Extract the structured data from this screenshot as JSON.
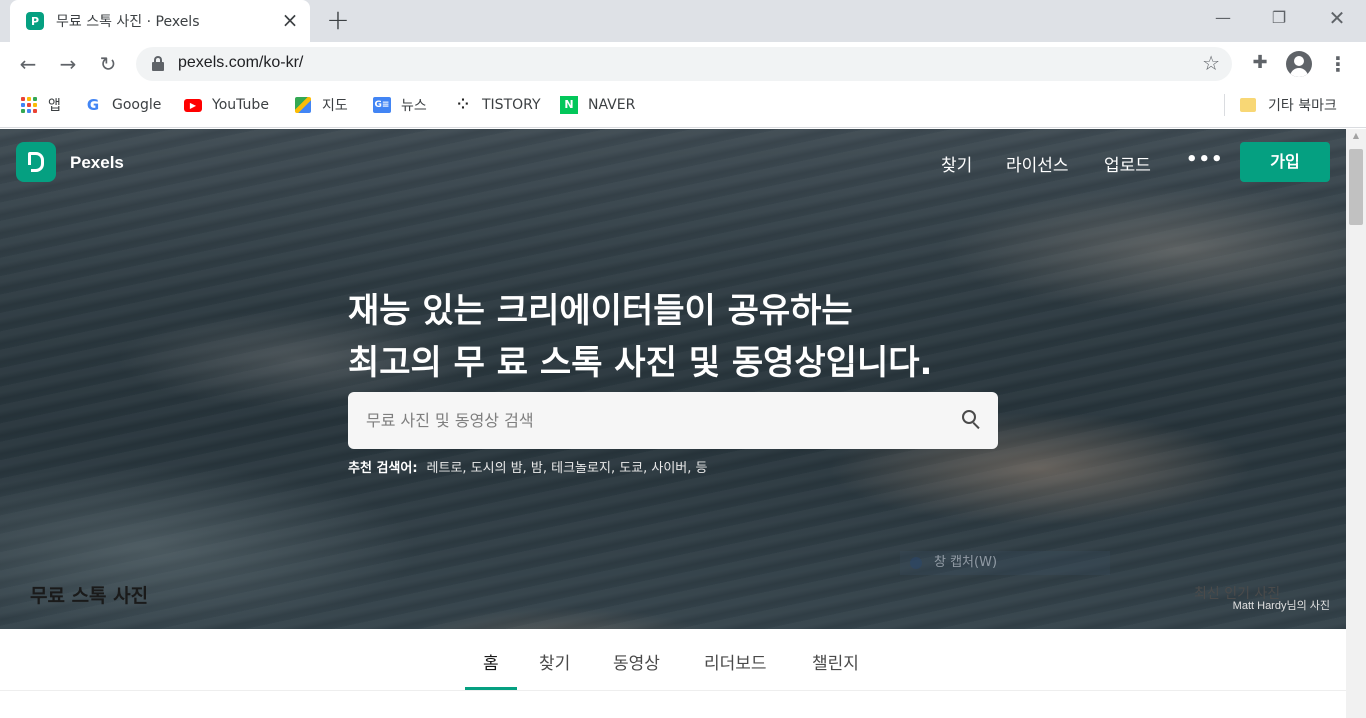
{
  "browser": {
    "tab": {
      "title": "무료 스톡 사진 · Pexels",
      "favicon": "P"
    },
    "url": "pexels.com/ko-kr/",
    "bookmarks": [
      {
        "label": "앱",
        "icon": "apps-icon"
      },
      {
        "label": "Google",
        "icon": "google-icon"
      },
      {
        "label": "YouTube",
        "icon": "youtube-icon"
      },
      {
        "label": "지도",
        "icon": "maps-icon"
      },
      {
        "label": "뉴스",
        "icon": "news-icon"
      },
      {
        "label": "TISTORY",
        "icon": "tistory-icon"
      },
      {
        "label": "NAVER",
        "icon": "naver-icon"
      }
    ],
    "other_bookmarks": "기타 북마크"
  },
  "site": {
    "brand": "Pexels",
    "nav": {
      "explore": "찾기",
      "license": "라이선스",
      "upload": "업로드",
      "more": "•••",
      "join": "가입"
    },
    "hero": {
      "headline_line1": "재능 있는 크리에이터들이 공유하는",
      "headline_line2": "최고의 무 료 스톡 사진 및 동영상입니다.",
      "search_placeholder": "무료 사진 및 동영상 검색",
      "suggest_label": "추천 검색어:",
      "suggestions": "레트로, 도시의 밤, 밤, 테크놀로지, 도쿄, 사이버, 등",
      "capture_overlay": "창 캡처(W)",
      "credit": "Matt Hardy님의 사진"
    },
    "subnav": {
      "tabs": [
        {
          "label": "홈",
          "active": true
        },
        {
          "label": "찾기",
          "active": false
        },
        {
          "label": "동영상",
          "active": false
        },
        {
          "label": "리더보드",
          "active": false
        },
        {
          "label": "챌린지",
          "active": false
        }
      ]
    },
    "section": {
      "title": "무료 스톡 사진",
      "sort": "최신 인기 사진"
    },
    "colors": {
      "brand_green": "#05a081"
    }
  }
}
